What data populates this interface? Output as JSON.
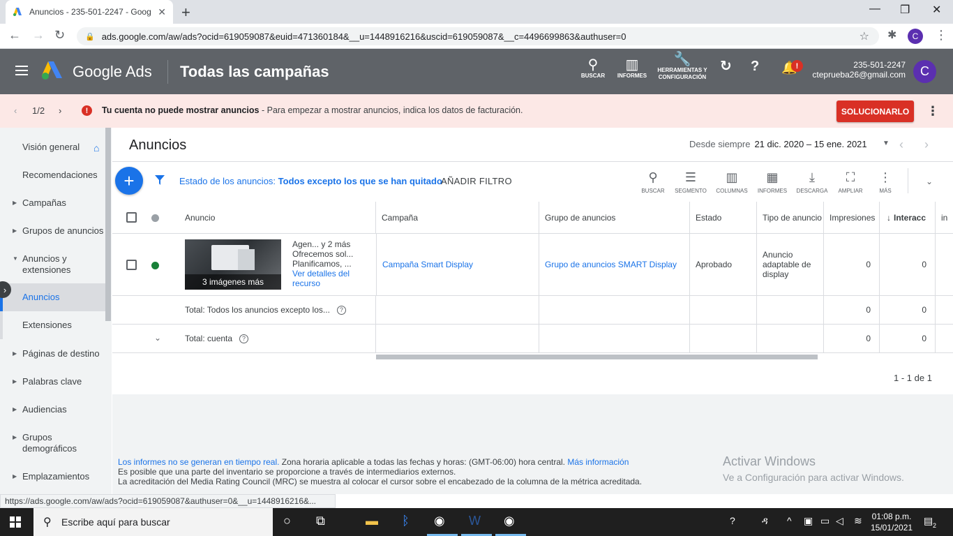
{
  "browser": {
    "tab_title": "Anuncios - 235-501-2247 - Goog",
    "url": "ads.google.com/aw/ads?ocid=619059087&euid=471360184&__u=1448916216&uscid=619059087&__c=4496699863&authuser=0",
    "profile_initial": "C",
    "status_url": "https://ads.google.com/aw/ads?ocid=619059087&authuser=0&__u=1448916216&..."
  },
  "header": {
    "brand": "Google Ads",
    "page_title": "Todas las campañas",
    "tools": [
      {
        "label": "BUSCAR",
        "icon": "search-icon"
      },
      {
        "label": "INFORMES",
        "icon": "reports-icon"
      },
      {
        "label": "HERRAMIENTAS Y CONFIGURACIÓN",
        "icon": "wrench-icon"
      }
    ],
    "account_id": "235-501-2247",
    "account_email": "cteprueba26@gmail.com",
    "avatar_initial": "C",
    "notification_badge": "!"
  },
  "alert": {
    "pagination": "1/2",
    "title": "Tu cuenta no puede mostrar anuncios",
    "message": " - Para empezar a mostrar anuncios, indica los datos de facturación.",
    "button": "SOLUCIONARLO"
  },
  "sidebar": {
    "items": [
      {
        "label": "Visión general"
      },
      {
        "label": "Recomendaciones"
      },
      {
        "label": "Campañas"
      },
      {
        "label": "Grupos de anuncios"
      },
      {
        "label": "Anuncios y extensiones"
      },
      {
        "label": "Anuncios"
      },
      {
        "label": "Extensiones"
      },
      {
        "label": "Páginas de destino"
      },
      {
        "label": "Palabras clave"
      },
      {
        "label": "Audiencias"
      },
      {
        "label": "Grupos demográficos"
      },
      {
        "label": "Emplazamientos"
      }
    ]
  },
  "main": {
    "heading": "Anuncios",
    "date_label": "Desde siempre",
    "date_range": "21 dic. 2020 – 15 ene. 2021",
    "filter_prefix": "Estado de los anuncios: ",
    "filter_value": "Todos excepto los que se han quitado",
    "add_filter": "AÑADIR FILTRO",
    "table_tools": [
      "BUSCAR",
      "SEGMENTO",
      "COLUMNAS",
      "INFORMES",
      "DESCARGA",
      "AMPLIAR",
      "MÁS"
    ],
    "columns": [
      "Anuncio",
      "Campaña",
      "Grupo de anuncios",
      "Estado",
      "Tipo de anuncio",
      "Impresiones",
      "Interacc",
      "in"
    ],
    "row": {
      "thumb_caption": "3 imágenes más",
      "line1": "Agen...    y 2 más",
      "line2": "Ofrecemos sol...",
      "line3": "Planificamos, ...",
      "details_link": "Ver detalles del recurso",
      "campaign": "Campaña Smart Display",
      "ad_group": "Grupo de anuncios SMART Display",
      "status": "Aprobado",
      "type": "Anuncio adaptable de display",
      "impressions": "0",
      "interactions": "0"
    },
    "total_filtered": {
      "label": "Total: Todos los anuncios excepto los...",
      "impressions": "0",
      "interactions": "0"
    },
    "total_account": {
      "label": "Total: cuenta",
      "impressions": "0",
      "interactions": "0"
    },
    "pagination": "1 - 1 de 1"
  },
  "footer": {
    "link1": "Los informes no se generan en tiempo real.",
    "text1": " Zona horaria aplicable a todas las fechas y horas: (GMT-06:00) hora central. ",
    "link2": "Más información",
    "line2": "Es posible que una parte del inventario se proporcione a través de intermediarios externos.",
    "line3": "La acreditación del Media Rating Council (MRC) se muestra al colocar el cursor sobre el encabezado de la columna de la métrica acreditada."
  },
  "watermark": {
    "title": "Activar Windows",
    "subtitle": "Ve a Configuración para activar Windows."
  },
  "taskbar": {
    "search_placeholder": "Escribe aquí para buscar",
    "time": "01:08 p.m.",
    "date": "15/01/2021",
    "notif_count": "2"
  },
  "colors": {
    "accent": "#1a73e8",
    "header_bg": "#5f6368",
    "alert_bg": "#fce8e6",
    "danger": "#d93025",
    "approved": "#188038"
  }
}
